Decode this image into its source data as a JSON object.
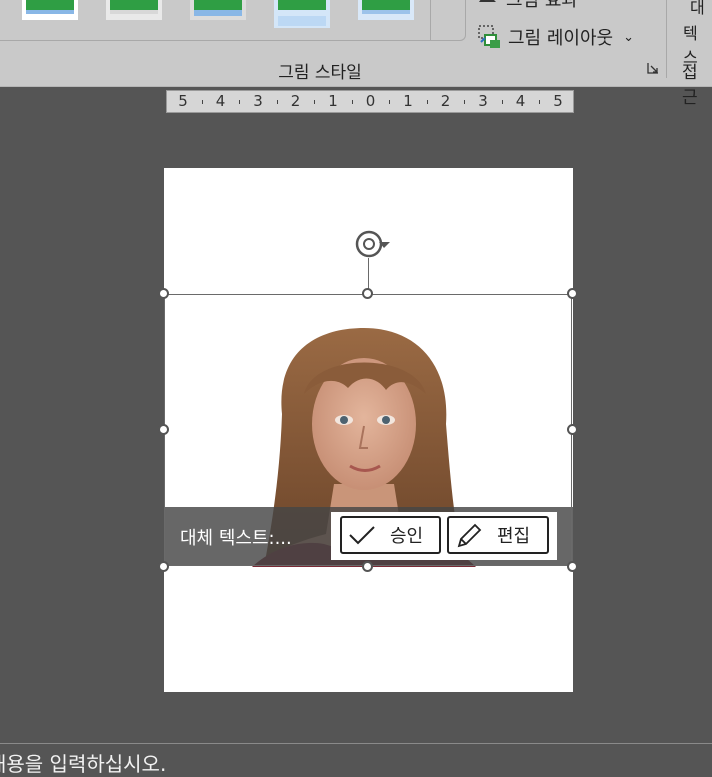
{
  "ribbon": {
    "group_label": "그림 스타일",
    "picture_border_label": "그림 효과",
    "picture_layout_label": "그림 레이아웃",
    "accessibility_label": "접근",
    "side_top": "대",
    "side_mid": "텍스"
  },
  "ruler": {
    "labels": [
      "5",
      "4",
      "3",
      "2",
      "1",
      "0",
      "1",
      "2",
      "3",
      "4",
      "5"
    ]
  },
  "alt_text_bar": {
    "text": "대체 텍스트:...",
    "approve_label": "승인",
    "edit_label": "편집"
  },
  "status": {
    "bottom_text": "내용을 입력하십시오."
  },
  "colors": {
    "ribbon_bg": "#c9c9c9",
    "canvas_bg": "#555555",
    "thumb_green": "#2f9e44",
    "thumb_blue": "#89b7e6"
  }
}
